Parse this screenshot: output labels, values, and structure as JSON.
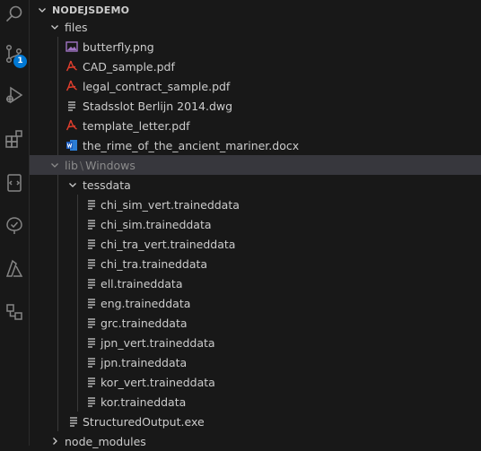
{
  "badges": {
    "source_control": "1"
  },
  "colors": {
    "accent": "#0078d4",
    "pdf": "#e03e2d",
    "image": "#a074c4",
    "docx": "#2b7cd3"
  },
  "explorer": {
    "workspace": "NODEJSDEMO",
    "files_folder": "files",
    "files": [
      {
        "name": "butterfly.png",
        "icon": "image-file-icon"
      },
      {
        "name": "CAD_sample.pdf",
        "icon": "pdf-file-icon"
      },
      {
        "name": "legal_contract_sample.pdf",
        "icon": "pdf-file-icon"
      },
      {
        "name": "Stadsslot Berlijn 2014.dwg",
        "icon": "generic-file-icon"
      },
      {
        "name": "template_letter.pdf",
        "icon": "pdf-file-icon"
      },
      {
        "name": "the_rime_of_the_ancient_mariner.docx",
        "icon": "word-file-icon"
      }
    ],
    "lib_folder": "lib",
    "lib_separator": "\\",
    "lib_sub": "Windows",
    "tessdata_folder": "tessdata",
    "tessdata": [
      "chi_sim_vert.traineddata",
      "chi_sim.traineddata",
      "chi_tra_vert.traineddata",
      "chi_tra.traineddata",
      "ell.traineddata",
      "eng.traineddata",
      "grc.traineddata",
      "jpn_vert.traineddata",
      "jpn.traineddata",
      "kor_vert.traineddata",
      "kor.traineddata"
    ],
    "structured_output": "StructuredOutput.exe",
    "node_modules": "node_modules"
  }
}
